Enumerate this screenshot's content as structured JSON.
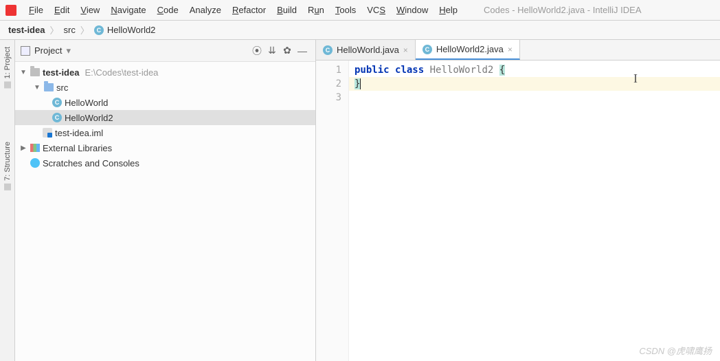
{
  "window_title": "Codes - HelloWorld2.java - IntelliJ IDEA",
  "menus": {
    "file": "File",
    "edit": "Edit",
    "view": "View",
    "navigate": "Navigate",
    "code": "Code",
    "analyze": "Analyze",
    "refactor": "Refactor",
    "build": "Build",
    "run": "Run",
    "tools": "Tools",
    "vcs": "VCS",
    "window": "Window",
    "help": "Help"
  },
  "breadcrumbs": {
    "root": "test-idea",
    "mid": "src",
    "leaf": "HelloWorld2"
  },
  "sidebar": {
    "title": "Project",
    "project": {
      "name": "test-idea",
      "path": "E:\\Codes\\test-idea"
    },
    "src_label": "src",
    "class1": "HelloWorld",
    "class2": "HelloWorld2",
    "iml": "test-idea.iml",
    "ext_lib": "External Libraries",
    "scratch": "Scratches and Consoles"
  },
  "left_tabs": {
    "project": "1: Project",
    "structure": "7: Structure"
  },
  "editor": {
    "tabs": {
      "t1": "HelloWorld.java",
      "t2": "HelloWorld2.java"
    },
    "gutter": {
      "l1": "1",
      "l2": "2",
      "l3": "3"
    },
    "code": {
      "kw_public": "public",
      "kw_class": "class",
      "classname": "HelloWorld2",
      "lb": "{",
      "rb": "}"
    }
  },
  "watermark": "CSDN @虎啸鹰扬"
}
